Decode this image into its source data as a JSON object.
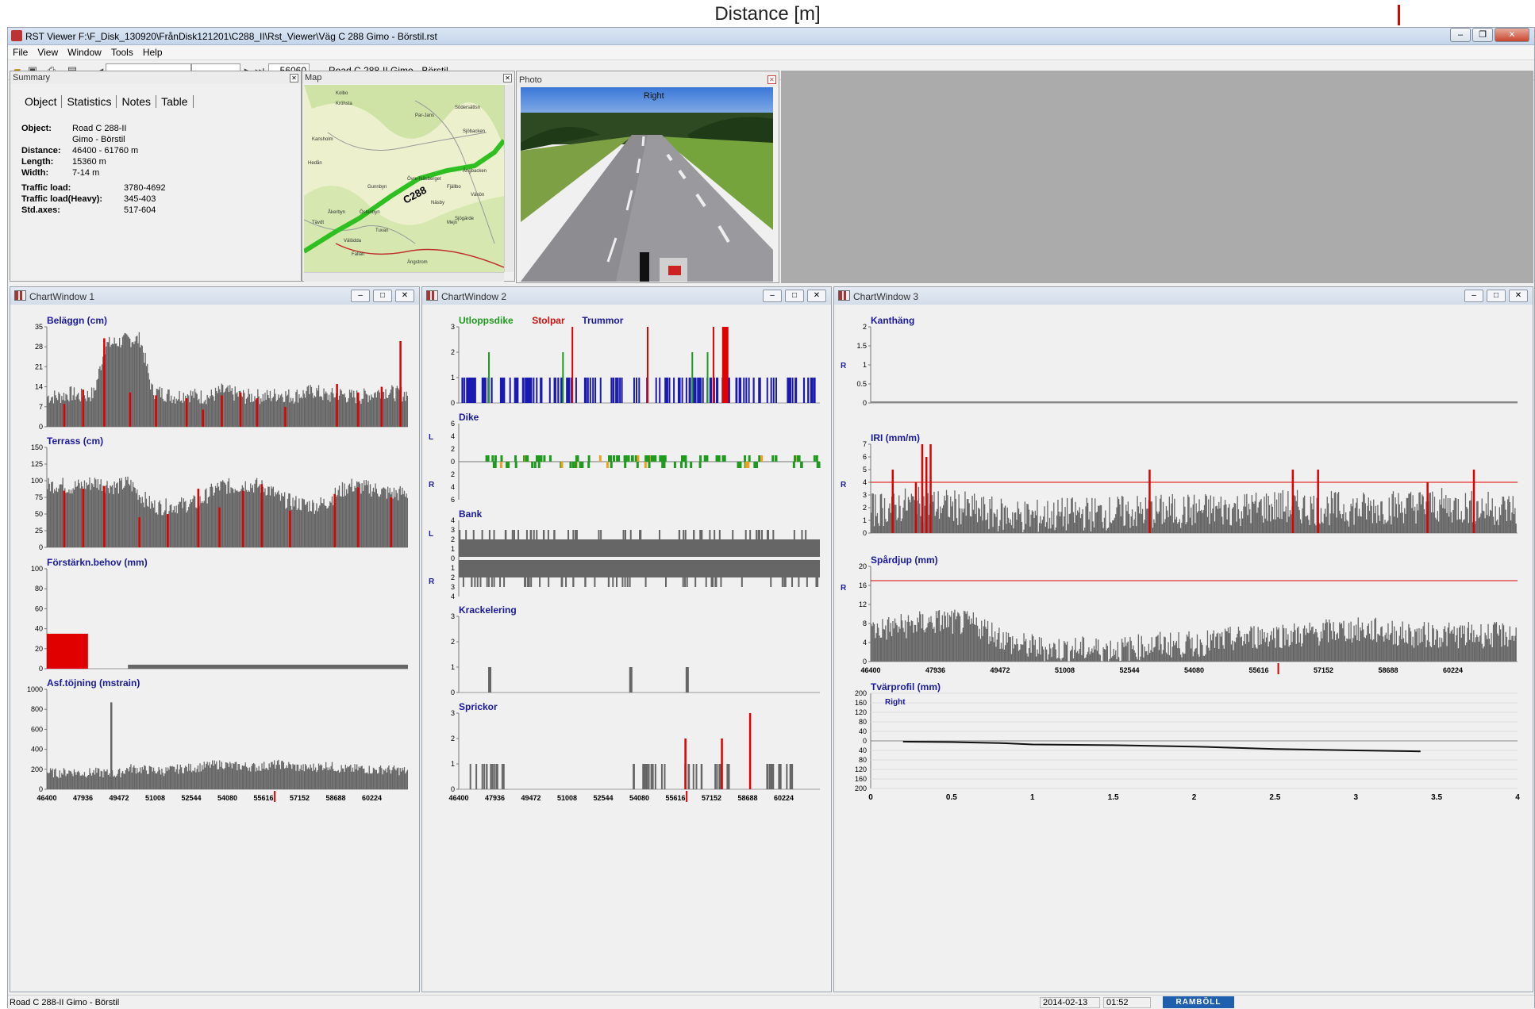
{
  "caption": "Distance [m]",
  "app": {
    "title": "RST Viewer  F:\\F_Disk_130920\\FrånDisk121201\\C288_II\\Rst_Viewer\\Väg C 288 Gimo - Börstil.rst"
  },
  "menu": [
    "File",
    "View",
    "Window",
    "Tools",
    "Help"
  ],
  "toolbar": {
    "position": "56060",
    "road": "Road C 288-II Gimo - Börstil"
  },
  "summary": {
    "title": "Summary",
    "tabs": [
      "Object",
      "Statistics",
      "Notes",
      "Table"
    ],
    "object_label": "Object:",
    "object_value1": "Road C 288-II",
    "object_value2": "Gimo - Börstil",
    "distance_label": "Distance:",
    "distance_value": "46400 - 61760 m",
    "length_label": "Length:",
    "length_value": "15360 m",
    "width_label": "Width:",
    "width_value": "7-14 m",
    "traffic_label": "Traffic load:",
    "traffic_value": "3780-4692",
    "heavy_label": "Traffic load(Heavy):",
    "heavy_value": "345-403",
    "axes_label": "Std.axes:",
    "axes_value": "517-604"
  },
  "map": {
    "title": "Map",
    "road_label": "C288",
    "places": [
      "Kolbo",
      "Kröhsta",
      "Par-Jans",
      "Södersättsn",
      "Sjöbacken",
      "Kansholm",
      "Hedån",
      "Ängbacken",
      "Övre-Näsberget",
      "Gunnbyn",
      "Åkerbyn",
      "Östanbyn",
      "Fjällbo",
      "Näsby",
      "Tävdt",
      "Mejn",
      "Vänön",
      "Fallan",
      "Ängstrom",
      "Välödda",
      "Sjögärde",
      "Tuvan"
    ]
  },
  "photo": {
    "title": "Photo",
    "side": "Right"
  },
  "chart_windows": [
    {
      "title": "ChartWindow 1"
    },
    {
      "title": "ChartWindow 2"
    },
    {
      "title": "ChartWindow 3"
    }
  ],
  "chart_data": [
    {
      "window": "ChartWindow 1",
      "type": "bar",
      "title": "Beläggn (cm)",
      "ylim": [
        0,
        35
      ],
      "yticks": [
        0,
        7,
        14,
        21,
        28,
        35
      ],
      "xlim": [
        46400,
        61760
      ],
      "profile": {
        "base": [
          10,
          10,
          11,
          10,
          11,
          28,
          29,
          30,
          30,
          12,
          11,
          10,
          11,
          10,
          10,
          12,
          11,
          10,
          10,
          10,
          11,
          10,
          11,
          12,
          10,
          11,
          10,
          10,
          11,
          12,
          11,
          11
        ],
        "noise": 4
      },
      "red_markers": [
        [
          47100,
          8
        ],
        [
          47900,
          13
        ],
        [
          48800,
          31
        ],
        [
          49900,
          12
        ],
        [
          51000,
          11
        ],
        [
          52300,
          10
        ],
        [
          53000,
          6
        ],
        [
          53800,
          11
        ],
        [
          54600,
          12
        ],
        [
          55300,
          10
        ],
        [
          56500,
          7
        ],
        [
          58700,
          15
        ],
        [
          59600,
          12
        ],
        [
          60600,
          14
        ],
        [
          61400,
          30
        ]
      ]
    },
    {
      "window": "ChartWindow 1",
      "type": "bar",
      "title": "Terrass (cm)",
      "ylim": [
        0,
        150
      ],
      "yticks": [
        0,
        25,
        50,
        75,
        100,
        125,
        150
      ],
      "xlim": [
        46400,
        61760
      ],
      "profile": {
        "base": [
          90,
          92,
          88,
          90,
          95,
          92,
          88,
          95,
          75,
          60,
          58,
          60,
          62,
          65,
          80,
          90,
          88,
          92,
          90,
          85,
          70,
          65,
          62,
          60,
          65,
          80,
          90,
          88,
          85,
          80,
          78,
          80
        ],
        "noise": 18
      },
      "red_markers": [
        [
          47100,
          85
        ],
        [
          47900,
          88
        ],
        [
          48800,
          92
        ],
        [
          50300,
          45
        ],
        [
          51500,
          50
        ],
        [
          52800,
          88
        ],
        [
          53700,
          60
        ],
        [
          54700,
          85
        ],
        [
          55500,
          95
        ],
        [
          56700,
          55
        ],
        [
          58600,
          80
        ],
        [
          59600,
          90
        ],
        [
          61000,
          75
        ]
      ]
    },
    {
      "window": "ChartWindow 1",
      "type": "bar",
      "title": "Förstärkn.behov (mm)",
      "ylim": [
        0,
        100
      ],
      "yticks": [
        0,
        20,
        40,
        60,
        80,
        100
      ],
      "xlim": [
        46400,
        61760
      ],
      "blocks": [
        {
          "from": 46400,
          "to": 48150,
          "value": 35,
          "color": "#e00000"
        },
        {
          "from": 49850,
          "to": 61760,
          "value": 4,
          "color": "#666666"
        }
      ]
    },
    {
      "window": "ChartWindow 1",
      "type": "bar",
      "title": "Asf.töjning (mstrain)",
      "ylim": [
        0,
        1000
      ],
      "yticks": [
        0,
        200,
        400,
        600,
        800,
        1000
      ],
      "xlim": [
        46400,
        61760
      ],
      "xticks": [
        46400,
        47936,
        49472,
        51008,
        52544,
        54080,
        55616,
        57152,
        58688,
        60224
      ],
      "profile": {
        "base": [
          160,
          150,
          170,
          150,
          160,
          150,
          140,
          200,
          190,
          180,
          170,
          190,
          200,
          210,
          230,
          240,
          220,
          220,
          210,
          230,
          240,
          220,
          200,
          210,
          230,
          200,
          190,
          200,
          180,
          190,
          180,
          170
        ],
        "noise": 70
      },
      "spikes": [
        [
          49100,
          870
        ]
      ]
    },
    {
      "window": "ChartWindow 2",
      "type": "bar",
      "title": "Utloppsdike Stolpar Trummor",
      "legend": [
        {
          "name": "Utloppsdike",
          "color": "#1e9a1e"
        },
        {
          "name": "Stolpar",
          "color": "#cc1111"
        },
        {
          "name": "Trummor",
          "color": "#1a1a9a"
        }
      ],
      "ylim": [
        0,
        3
      ],
      "yticks": [
        0,
        1,
        2,
        3
      ],
      "xlim": [
        46400,
        61760
      ]
    },
    {
      "window": "ChartWindow 2",
      "type": "bar",
      "title": "Dike",
      "ylim": [
        -6,
        6
      ],
      "side_labels": [
        "L",
        "R"
      ],
      "xlim": [
        46400,
        61760
      ]
    },
    {
      "window": "ChartWindow 2",
      "type": "bar",
      "title": "Bank",
      "ylim": [
        -4,
        4
      ],
      "side_labels": [
        "L",
        "R"
      ],
      "xlim": [
        46400,
        61760
      ]
    },
    {
      "window": "ChartWindow 2",
      "type": "bar",
      "title": "Krackelering",
      "ylim": [
        0,
        3
      ],
      "yticks": [
        0,
        1,
        2,
        3
      ],
      "xlim": [
        46400,
        61760
      ],
      "markers": [
        [
          47650,
          1
        ],
        [
          53650,
          1
        ],
        [
          56050,
          1
        ]
      ]
    },
    {
      "window": "ChartWindow 2",
      "type": "bar",
      "title": "Sprickor",
      "ylim": [
        0,
        3
      ],
      "yticks": [
        0,
        1,
        2,
        3
      ],
      "xlim": [
        46400,
        61760
      ],
      "xticks": [
        46400,
        47936,
        49472,
        51008,
        52544,
        54080,
        55616,
        57152,
        58688,
        60224
      ],
      "red_markers": [
        [
          56000,
          2
        ],
        [
          57550,
          2
        ],
        [
          58750,
          3
        ]
      ]
    },
    {
      "window": "ChartWindow 3",
      "type": "bar",
      "title": "Kanthäng",
      "ylim": [
        0,
        2
      ],
      "yticks": [
        0,
        0.5,
        1,
        1.5,
        2
      ],
      "side_label": "R",
      "xlim": [
        46400,
        61760
      ]
    },
    {
      "window": "ChartWindow 3",
      "type": "bar",
      "title": "IRI (mm/m)",
      "ylim": [
        0,
        7
      ],
      "yticks": [
        0,
        1,
        2,
        3,
        4,
        5,
        6,
        7
      ],
      "side_label": "R",
      "threshold": 4,
      "xlim": [
        46400,
        61760
      ],
      "red_markers": [
        [
          46900,
          5
        ],
        [
          47450,
          4
        ],
        [
          47600,
          7
        ],
        [
          47700,
          6
        ],
        [
          47800,
          7
        ],
        [
          53000,
          5
        ],
        [
          56400,
          5
        ],
        [
          57000,
          5
        ],
        [
          59600,
          4
        ],
        [
          60700,
          5
        ]
      ]
    },
    {
      "window": "ChartWindow 3",
      "type": "bar",
      "title": "Spårdjup (mm)",
      "ylim": [
        0,
        20
      ],
      "yticks": [
        0,
        4,
        8,
        12,
        16,
        20
      ],
      "side_label": "R",
      "threshold": 17,
      "xlim": [
        46400,
        61760
      ],
      "xticks": [
        46400,
        47936,
        49472,
        51008,
        52544,
        54080,
        55616,
        57152,
        58688,
        60224
      ]
    },
    {
      "window": "ChartWindow 3",
      "type": "line",
      "title": "Tvärprofil (mm)",
      "label": "Right",
      "ylim": [
        -200,
        200
      ],
      "yticks": [
        "200",
        "160",
        "120",
        "80",
        "40",
        "0",
        "40",
        "80",
        "120",
        "160",
        "200"
      ],
      "xlim": [
        0,
        4
      ],
      "xticks": [
        "0",
        "0.5",
        "1",
        "1.5",
        "2",
        "2.5",
        "3",
        "3.5",
        "4"
      ],
      "x": [
        0.2,
        0.5,
        0.8,
        1.0,
        1.5,
        2.0,
        2.5,
        3.0,
        3.4
      ],
      "y": [
        -3,
        -5,
        -9,
        -15,
        -18,
        -24,
        -34,
        -40,
        -44
      ]
    }
  ],
  "status": {
    "road": "Road C 288-II Gimo - Börstil",
    "date": "2014-02-13",
    "time": "01:52",
    "brand": "RAMBÖLL"
  },
  "colors": {
    "bar": "#666666",
    "red": "#e00000",
    "title": "#1a1a9a",
    "green": "#1e9a1e",
    "orange": "#f0a020",
    "blue": "#1a1ab0"
  }
}
